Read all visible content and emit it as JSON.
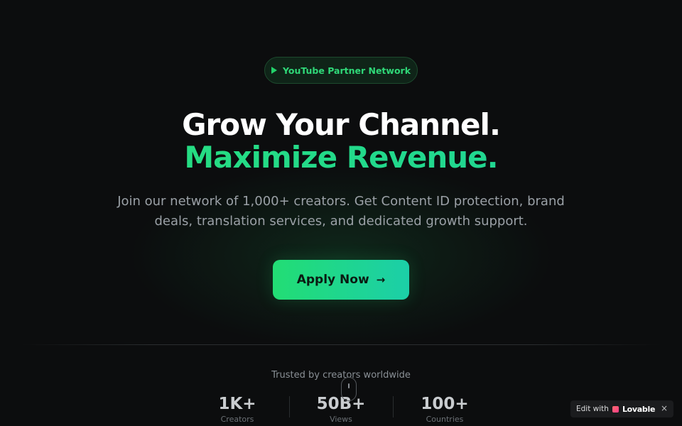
{
  "badge": {
    "label": "YouTube Partner Network",
    "icon": "play-icon"
  },
  "hero": {
    "title_line1": "Grow Your Channel.",
    "title_line2": "Maximize Revenue.",
    "subtitle": "Join our network of 1,000+ creators. Get Content ID protection, brand deals, translation services, and dedicated growth support."
  },
  "cta": {
    "label": "Apply Now",
    "icon": "arrow-right-icon",
    "arrow_glyph": "→"
  },
  "trusted": {
    "label": "Trusted by creators worldwide"
  },
  "stats": [
    {
      "value": "1K+",
      "label": "Creators"
    },
    {
      "value": "50B+",
      "label": "Views"
    },
    {
      "value": "100+",
      "label": "Countries"
    }
  ],
  "lovable_badge": {
    "edit_with": "Edit with",
    "brand": "Lovable",
    "close_glyph": "×"
  },
  "colors": {
    "background": "#0c0d0e",
    "accent": "#22dd74",
    "accent_teal": "#1ccfa8"
  }
}
